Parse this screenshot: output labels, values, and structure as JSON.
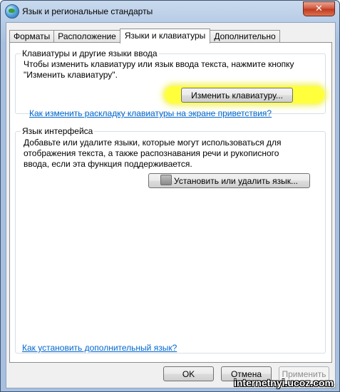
{
  "window": {
    "title": "Язык и региональные стандарты",
    "close_label": "✕"
  },
  "tabs": [
    {
      "label": "Форматы"
    },
    {
      "label": "Расположение"
    },
    {
      "label": "Языки и клавиатуры"
    },
    {
      "label": "Дополнительно"
    }
  ],
  "active_tab": "Языки и клавиатуры",
  "keyboards_group": {
    "title": "Клавиатуры и другие языки ввода",
    "text_line1": "Чтобы изменить клавиатуру или язык ввода текста, нажмите кнопку",
    "text_line2": "\"Изменить клавиатуру\".",
    "change_button": "Изменить клавиатуру...",
    "link": "Как изменить раскладку клавиатуры на экране приветствия?"
  },
  "display_language_group": {
    "title": "Язык интерфейса",
    "text_line1": "Добавьте или удалите языки, которые могут использоваться для",
    "text_line2": "отображения текста, а также распознавания речи и рукописного",
    "text_line3": "ввода, если эта функция поддерживается.",
    "install_button": "Установить или удалить язык..."
  },
  "bottom_link": "Как установить дополнительный язык?",
  "buttons": {
    "ok": "OK",
    "cancel": "Отмена",
    "apply": "Применить"
  },
  "watermark": "internetnyi.ucoz.com",
  "colors": {
    "highlight": "#ffff3b",
    "link": "#0066cc",
    "close_button": "#c0381e"
  }
}
